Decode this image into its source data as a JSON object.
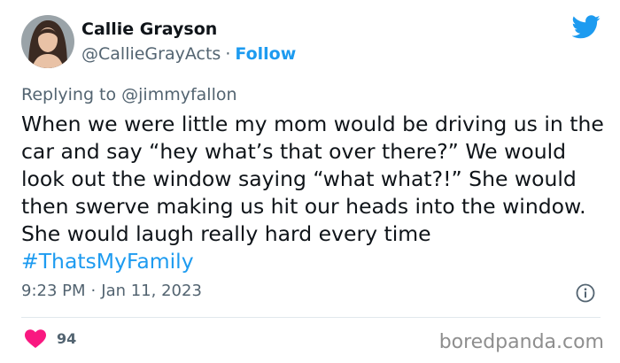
{
  "tweet": {
    "author_name": "Callie Grayson",
    "handle": "@CallieGrayActs",
    "separator": "·",
    "follow_label": "Follow",
    "replying_prefix": "Replying to ",
    "replying_to": "@jimmyfallon",
    "body_text": "When we were little my mom would be driving us in the car and say “hey what’s that over there?” We would look out the window saying “what what?!” She would then swerve making us hit our heads into the window. She would laugh really hard every time ",
    "hashtag": "#ThatsMyFamily",
    "time": "9:23 PM",
    "date": "Jan 11, 2023",
    "likes_count": "94"
  },
  "icons": {
    "brand": "twitter-bird-icon",
    "info": "info-icon",
    "like": "heart-icon"
  },
  "colors": {
    "accent": "#1d9bf0",
    "like": "#f91880",
    "muted_text": "#536471",
    "primary_text": "#0f1419"
  },
  "watermark": "boredpanda.com"
}
